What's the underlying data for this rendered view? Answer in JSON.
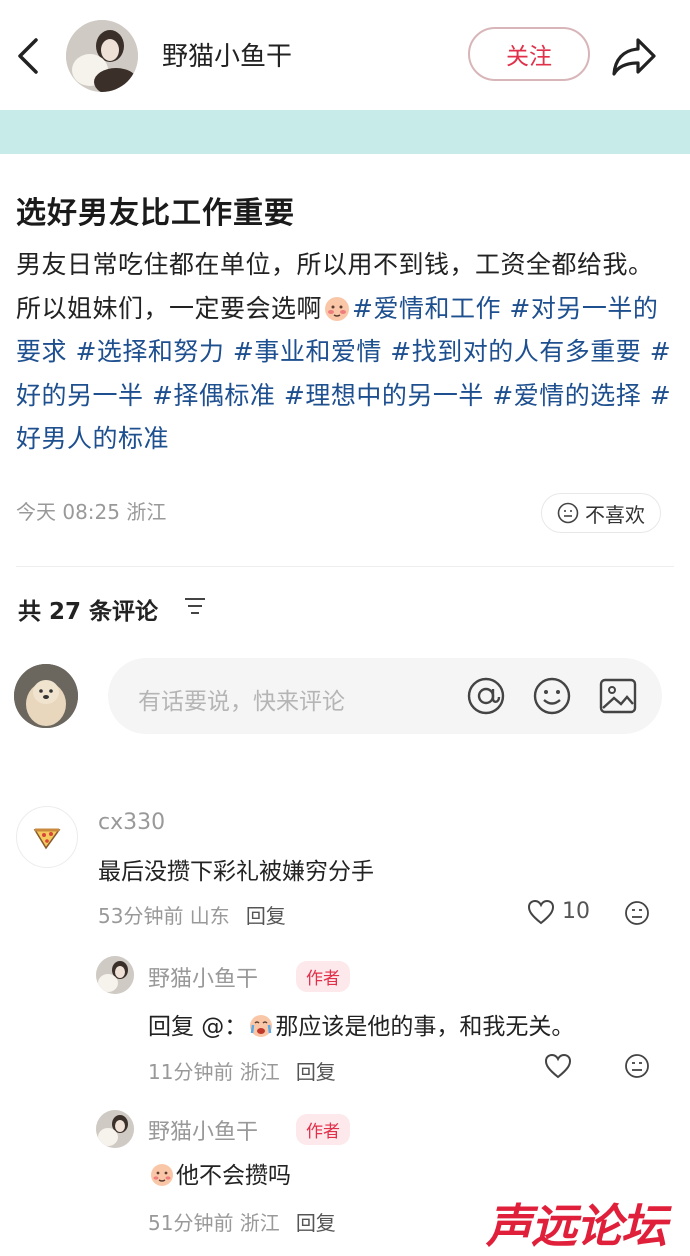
{
  "header": {
    "author_name": "野猫小鱼干",
    "follow_label": "关注"
  },
  "post": {
    "title": "选好男友比工作重要",
    "body_text_1": "男友日常吃住都在单位，所以用不到钱，工资全都给我。所以姐妹们，一定要会选啊",
    "tags": [
      "#爱情和工作",
      "#对另一半的要求",
      "#选择和努力",
      "#事业和爱情",
      "#找到对的人有多重要",
      "#好的另一半",
      "#择偶标准",
      "#理想中的另一半",
      "#爱情的选择",
      "#好男人的标准"
    ],
    "meta": "今天 08:25 浙江",
    "dislike_label": "不喜欢"
  },
  "comments_section": {
    "count_label": "共 27 条评论",
    "input_placeholder": "有话要说，快来评论"
  },
  "comments": [
    {
      "user": "cx330",
      "text": "最后没攒下彩礼被嫌穷分手",
      "time_location": "53分钟前 山东",
      "reply_label": "回复",
      "likes": "10"
    }
  ],
  "replies": [
    {
      "user": "野猫小鱼干",
      "badge": "作者",
      "text_prefix": "回复 @：",
      "text": "那应该是他的事，和我无关。",
      "time_location": "11分钟前 浙江",
      "reply_label": "回复"
    },
    {
      "user": "野猫小鱼干",
      "badge": "作者",
      "text": "他不会攒吗",
      "time_location": "51分钟前 浙江",
      "reply_label": "回复"
    }
  ],
  "watermark": "声远论坛",
  "colors": {
    "accent": "#e0304a",
    "tag": "#1e4f8f",
    "banner": "#c6ebe8"
  }
}
